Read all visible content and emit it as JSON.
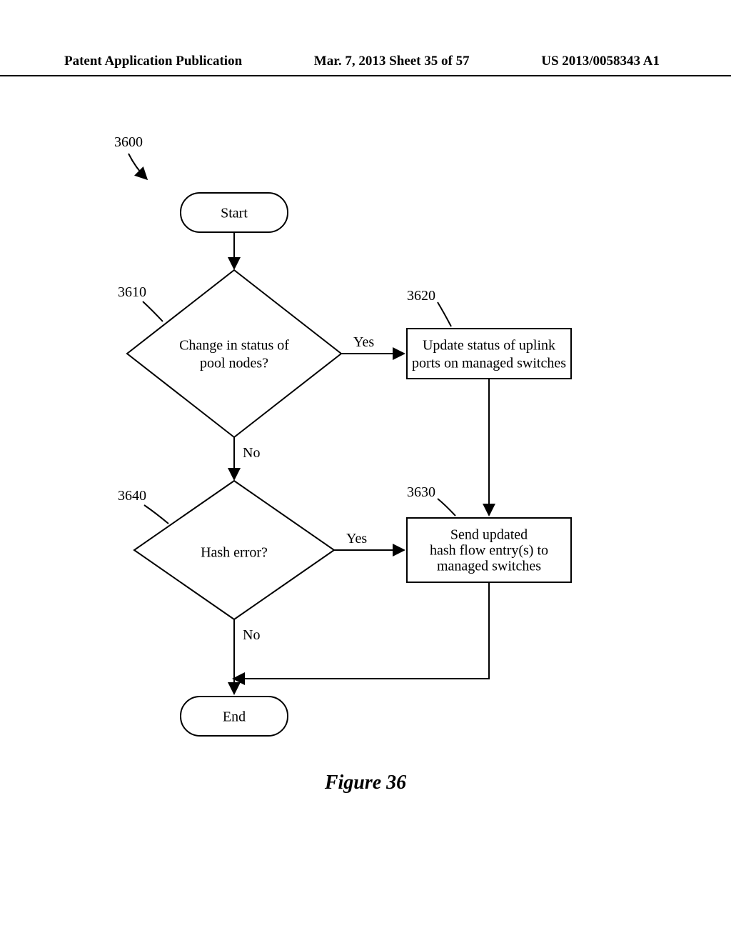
{
  "header": {
    "left": "Patent Application Publication",
    "center": "Mar. 7, 2013  Sheet 35 of 57",
    "right": "US 2013/0058343 A1"
  },
  "flow": {
    "ref_main": "3600",
    "start": "Start",
    "end": "End",
    "decision1": {
      "ref": "3610",
      "text_l1": "Change in status of",
      "text_l2": "pool nodes?",
      "yes": "Yes",
      "no": "No"
    },
    "process1": {
      "ref": "3620",
      "text_l1": "Update status of uplink",
      "text_l2": "ports on managed switches"
    },
    "decision2": {
      "ref": "3640",
      "text": "Hash error?",
      "yes": "Yes",
      "no": "No"
    },
    "process2": {
      "ref": "3630",
      "text_l1": "Send updated",
      "text_l2": "hash flow entry(s) to",
      "text_l3": "managed switches"
    }
  },
  "caption": "Figure 36"
}
